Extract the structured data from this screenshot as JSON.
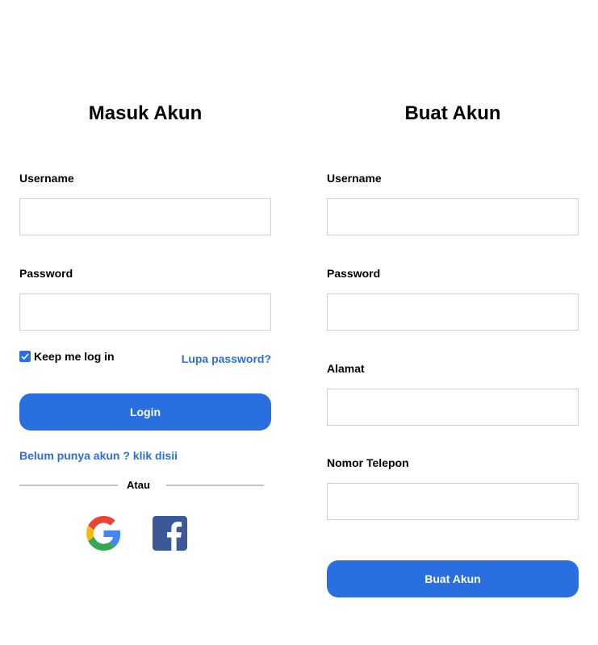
{
  "login": {
    "title": "Masuk Akun",
    "username_label": "Username",
    "username_value": "",
    "password_label": "Password",
    "password_value": "",
    "keep_logged_in_label": "Keep me log in",
    "keep_logged_in_checked": true,
    "forgot_password_link": "Lupa password?",
    "login_button": "Login",
    "signup_link": "Belum punya akun ? klik disii",
    "divider_text": "Atau",
    "social": [
      "google-icon",
      "facebook-icon"
    ]
  },
  "register": {
    "title": "Buat Akun",
    "username_label": "Username",
    "username_value": "",
    "password_label": "Password",
    "password_value": "",
    "address_label": "Alamat",
    "address_value": "",
    "phone_label": "Nomor Telepon",
    "phone_value": "",
    "submit_button": "Buat Akun"
  },
  "colors": {
    "accent": "#2a6fe0",
    "facebook": "#3b5998",
    "field_border": "#d0d0d0"
  }
}
